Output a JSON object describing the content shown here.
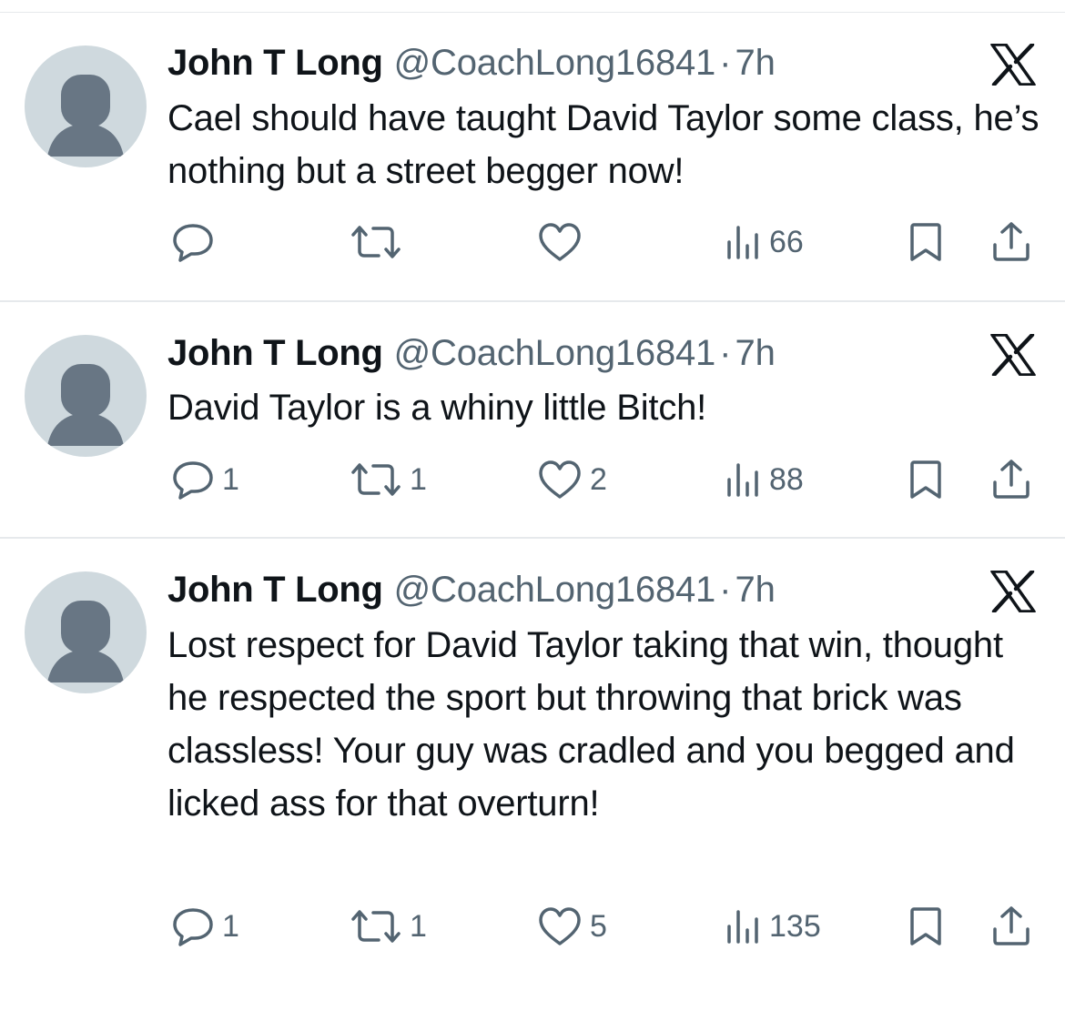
{
  "tweets": [
    {
      "author": {
        "name": "John T Long",
        "handle": "@CoachLong16841",
        "separator": "·",
        "time": "7h"
      },
      "text": "Cael should have taught David Taylor some class, he’s nothing but a street begger now!",
      "replies": "",
      "retweets": "",
      "likes": "",
      "views": "66"
    },
    {
      "author": {
        "name": "John T Long",
        "handle": "@CoachLong16841",
        "separator": "·",
        "time": "7h"
      },
      "text": "David Taylor is a whiny little Bitch!",
      "replies": "1",
      "retweets": "1",
      "likes": "2",
      "views": "88"
    },
    {
      "author": {
        "name": "John T Long",
        "handle": "@CoachLong16841",
        "separator": "·",
        "time": "7h"
      },
      "text": "Lost respect for David Taylor taking that win, thought he respected the sport but throwing that brick was classless! Your guy was cradled and you begged and licked ass for that overturn!",
      "replies": "1",
      "retweets": "1",
      "likes": "5",
      "views": "135"
    }
  ],
  "icons": {
    "avatar": "default-avatar-icon",
    "platform": "x-logo-icon",
    "reply": "reply-icon",
    "retweet": "retweet-icon",
    "like": "heart-icon",
    "views": "views-chart-icon",
    "bookmark": "bookmark-icon",
    "share": "share-icon"
  },
  "colors": {
    "text": "#0f1419",
    "secondary": "#536471",
    "avatar_bg": "#cfd9de",
    "avatar_fg": "#687684",
    "divider": "#e6e9ec"
  }
}
